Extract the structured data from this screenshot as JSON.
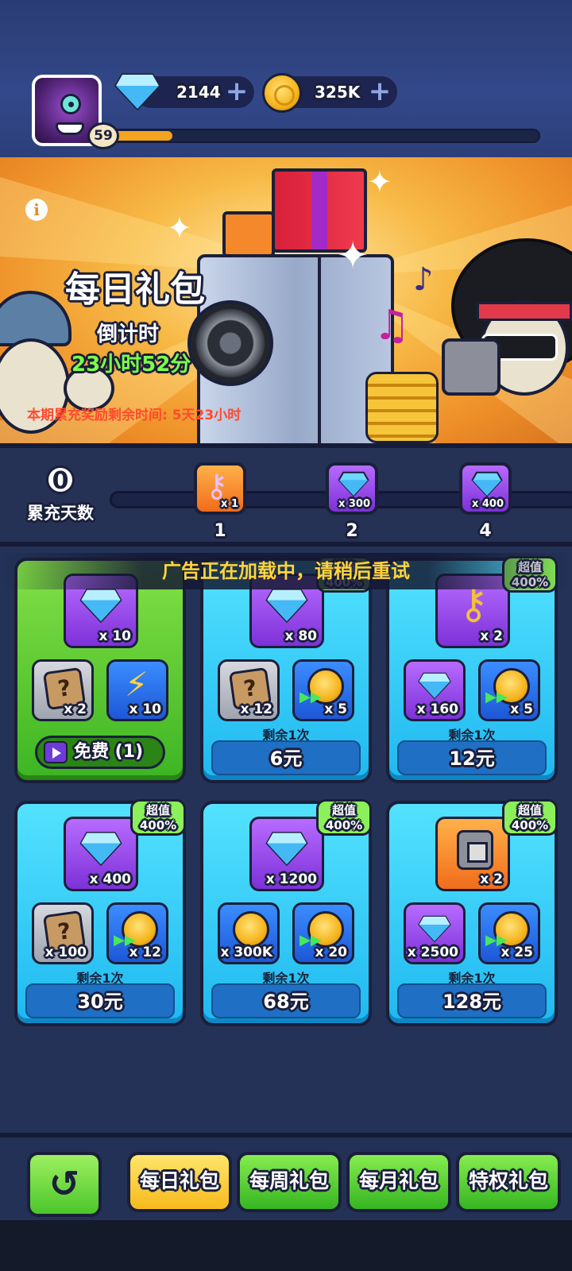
{
  "header": {
    "level": "59",
    "xp_fraction": 0.14,
    "gems": "2144",
    "coins": "325K",
    "add_icon": "plus-icon"
  },
  "banner": {
    "title": "每日礼包",
    "countdown_label": "倒计时",
    "countdown": "23小时52分",
    "notice": "本期累充奖励剩余时间: 5天23小时",
    "info_icon": "i"
  },
  "progress": {
    "days": "0",
    "days_label": "累充天数",
    "milestones": [
      {
        "day": "1",
        "qty": "x 1",
        "icon": "key-icon"
      },
      {
        "day": "2",
        "qty": "x 300",
        "icon": "gem-icon"
      },
      {
        "day": "4",
        "qty": "x 400",
        "icon": "gem-icon"
      }
    ]
  },
  "toast": "广告正在加载中，请稍后重试",
  "packs": [
    {
      "main_qty": "x 10",
      "left_qty": "x 2",
      "right_qty": "x 10",
      "free_label": "免费 (1)"
    },
    {
      "main_qty": "x 80",
      "left_qty": "x 12",
      "right_qty": "x 5",
      "remain": "剩余1次",
      "price": "6元",
      "badge1": "超值",
      "badge2": "400%"
    },
    {
      "main_qty": "x 2",
      "left_qty": "x 160",
      "right_qty": "x 5",
      "remain": "剩余1次",
      "price": "12元",
      "badge1": "超值",
      "badge2": "400%"
    },
    {
      "main_qty": "x 400",
      "left_qty": "x 100",
      "right_qty": "x 12",
      "remain": "剩余1次",
      "price": "30元",
      "badge1": "超值",
      "badge2": "400%"
    },
    {
      "main_qty": "x 1200",
      "left_qty": "x 300K",
      "right_qty": "x 20",
      "remain": "剩余1次",
      "price": "68元",
      "badge1": "超值",
      "badge2": "400%"
    },
    {
      "main_qty": "x 2",
      "left_qty": "x 2500",
      "right_qty": "x 25",
      "remain": "剩余1次",
      "price": "128元",
      "badge1": "超值",
      "badge2": "400%"
    }
  ],
  "tabs": {
    "back_icon": "back-arrow-icon",
    "daily": "每日礼包",
    "weekly": "每周礼包",
    "monthly": "每月礼包",
    "privilege": "特权礼包"
  },
  "colors": {
    "accent_yellow": "#f7b91d",
    "card_blue": "#1fb8f0",
    "card_green": "#3cb523",
    "badge_green": "#8bf05a"
  }
}
